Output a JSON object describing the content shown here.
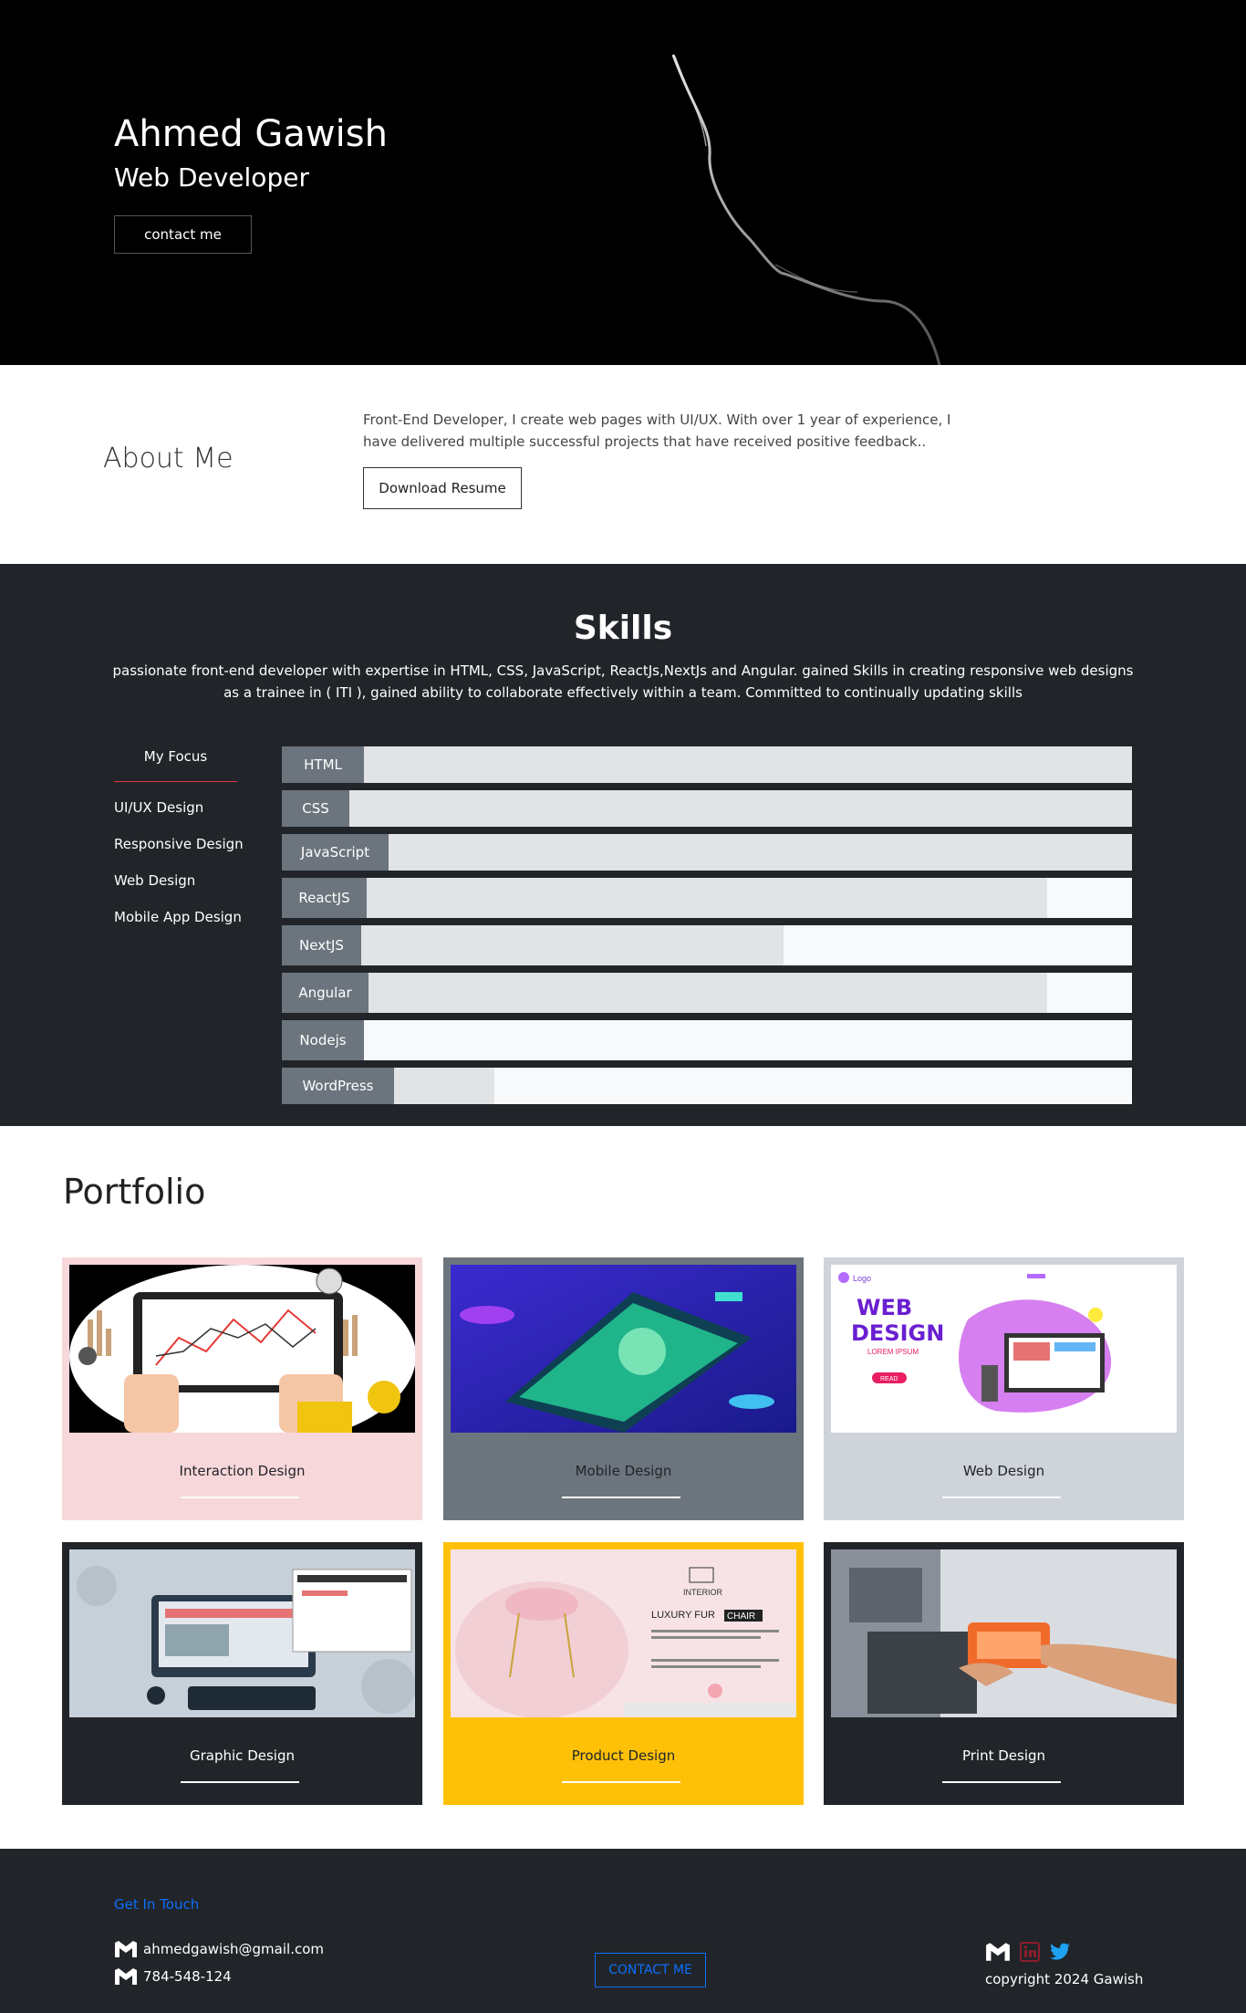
{
  "hero": {
    "name": "Ahmed Gawish",
    "role": "Web Developer",
    "button": "contact me"
  },
  "about": {
    "title": "About Me",
    "text": "Front-End Developer, I create web pages with UI/UX. With over 1 year of experience, I have delivered multiple successful projects that have received positive feedback..",
    "button": "Download Resume"
  },
  "skills": {
    "title": "Skills",
    "description": "passionate front-end developer with expertise in HTML, CSS, JavaScript, ReactJs,NextJs and Angular. gained Skills in creating responsive web designs as a trainee in ( ITI ), gained ability to collaborate effectively within a team. Committed to continually updating skills",
    "focus_title": "My Focus",
    "focus_items": [
      "UI/UX Design",
      "Responsive Design",
      "Web Design",
      "Mobile App Design"
    ],
    "bars": [
      {
        "label": "HTML",
        "level": 1.0
      },
      {
        "label": "CSS",
        "level": 1.0
      },
      {
        "label": "JavaScript",
        "level": 1.0
      },
      {
        "label": "ReactJS",
        "level": 0.9
      },
      {
        "label": "NextJS",
        "level": 0.59
      },
      {
        "label": "Angular",
        "level": 0.9
      },
      {
        "label": "Nodejs",
        "level": 0.0
      },
      {
        "label": "WordPress",
        "level": 0.25
      }
    ]
  },
  "portfolio": {
    "title": "Portfolio",
    "cards": [
      {
        "caption": "Interaction Design",
        "bg": "#f8d7da",
        "text": "#212529",
        "line": "#ffffff"
      },
      {
        "caption": "Mobile Design",
        "bg": "#6c757d",
        "text": "#212529",
        "line": "#ffffff"
      },
      {
        "caption": "Web Design",
        "bg": "#ced4da",
        "text": "#212529",
        "line": "#ffffff"
      },
      {
        "caption": "Graphic Design",
        "bg": "#212529",
        "text": "#ffffff",
        "line": "#ffffff"
      },
      {
        "caption": "Product Design",
        "bg": "#ffc107",
        "text": "#212529",
        "line": "#ffffff"
      },
      {
        "caption": "Print Design",
        "bg": "#212529",
        "text": "#ffffff",
        "line": "#ffffff"
      }
    ],
    "thumb_text": {
      "web_logo": "Logo",
      "web_title1": "WEB",
      "web_title2": "DESIGN",
      "web_sub": "LOREM IPSUM",
      "web_btn": "READ",
      "product_brand": "INTERIOR",
      "product_title1": "LUXURY FUR",
      "product_title2": "CHAIR"
    }
  },
  "footer": {
    "get_in_touch": "Get In Touch",
    "email": "ahmedgawish@gmail.com",
    "phone": "784-548-124",
    "button": "CONTACT ME",
    "copyright": "copyright 2024 Gawish"
  },
  "colors": {
    "dark": "#212529",
    "accent_blue": "#0d6efd",
    "focus_line": "#dc3545",
    "twitter": "#1da1f2",
    "linkedin": "#8b1e2d"
  }
}
